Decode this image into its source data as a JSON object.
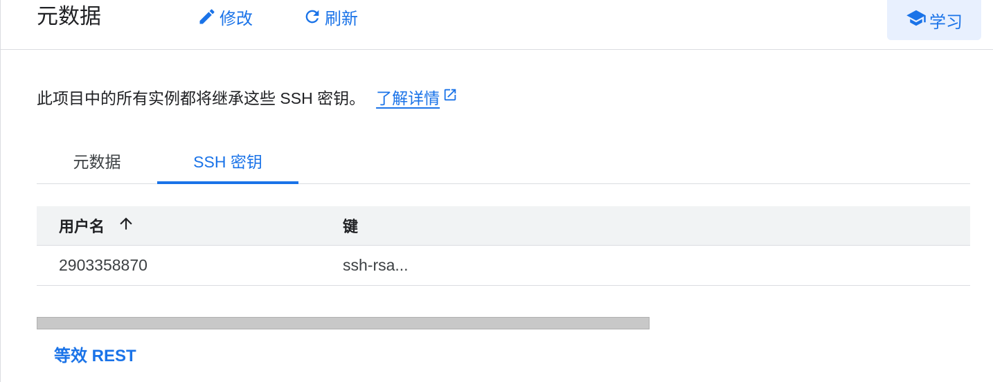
{
  "header": {
    "title": "元数据",
    "edit_label": "修改",
    "refresh_label": "刷新",
    "learn_label": "学习"
  },
  "description": {
    "text": "此项目中的所有实例都将继承这些 SSH 密钥。",
    "link_label": "了解详情"
  },
  "tabs": [
    {
      "label": "元数据",
      "active": false
    },
    {
      "label": "SSH 密钥",
      "active": true
    }
  ],
  "table": {
    "columns": [
      {
        "label": "用户名",
        "sort": "ascending"
      },
      {
        "label": "键"
      }
    ],
    "rows": [
      {
        "username": "2903358870",
        "key": "ssh-rsa..."
      }
    ]
  },
  "footer": {
    "rest_label": "等效 REST"
  },
  "colors": {
    "accent": "#1a73e8",
    "learn_bg": "#e8f0fe",
    "table_header_bg": "#f1f3f4",
    "divider": "#dadce0"
  },
  "icons": [
    "pencil-icon",
    "refresh-icon",
    "school-icon",
    "open-in-new-icon",
    "arrow-up-icon"
  ]
}
